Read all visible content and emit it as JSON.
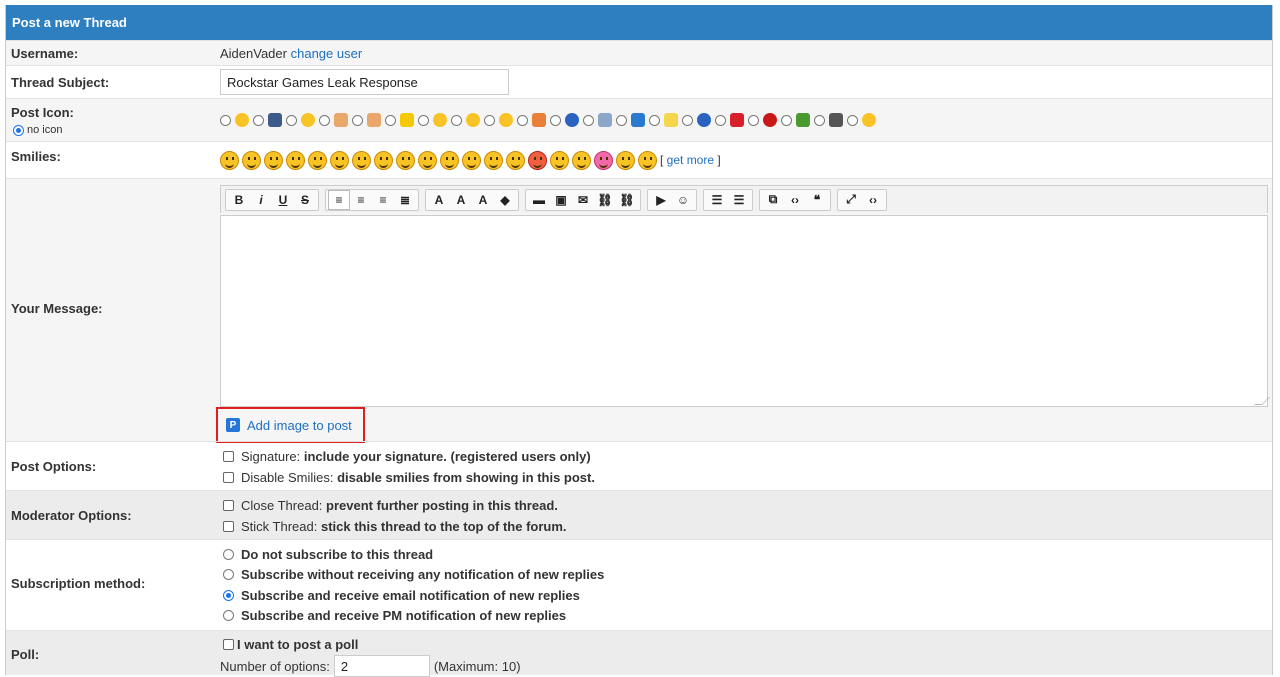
{
  "header": {
    "title": "Post a new Thread"
  },
  "username": {
    "label": "Username:",
    "value": "AidenVader",
    "change_link": "change user"
  },
  "subject": {
    "label": "Thread Subject:",
    "value": "Rockstar Games Leak Response"
  },
  "post_icon": {
    "label": "Post Icon:",
    "no_icon_label": "no icon",
    "icons": [
      {
        "name": "confused-icon",
        "color": "#f7c325"
      },
      {
        "name": "film-icon",
        "color": "#3c5a8a"
      },
      {
        "name": "tongue-icon",
        "color": "#f7c325"
      },
      {
        "name": "thumbs-up-icon",
        "color": "#e9a86a"
      },
      {
        "name": "thumbs-down-icon",
        "color": "#e9a86a"
      },
      {
        "name": "star-icon",
        "color": "#f5c800"
      },
      {
        "name": "big-grin-icon",
        "color": "#f7c325"
      },
      {
        "name": "angry-icon",
        "color": "#f7c325"
      },
      {
        "name": "neutral-icon",
        "color": "#f7c325"
      },
      {
        "name": "rainbow-icon",
        "color": "#e8803a"
      },
      {
        "name": "question-icon",
        "color": "#2a62c0"
      },
      {
        "name": "image-icon",
        "color": "#8aa8c8"
      },
      {
        "name": "music-icon",
        "color": "#2a7ad0"
      },
      {
        "name": "lightbulb-icon",
        "color": "#f5d54a"
      },
      {
        "name": "info-icon",
        "color": "#2a62c0"
      },
      {
        "name": "heart-icon",
        "color": "#d8202a"
      },
      {
        "name": "exclamation-icon",
        "color": "#c81818"
      },
      {
        "name": "bug-icon",
        "color": "#4a9a30"
      },
      {
        "name": "clapper-icon",
        "color": "#555555"
      },
      {
        "name": "laughing-icon",
        "color": "#f7c325"
      }
    ]
  },
  "smilies": {
    "label": "Smilies:",
    "count": 20,
    "get_more": "get more"
  },
  "message": {
    "label": "Your Message:",
    "add_image": "Add image to post"
  },
  "toolbar": {
    "groups": [
      [
        "B",
        "i",
        "U",
        "S"
      ],
      [
        "align-left",
        "align-center",
        "align-right",
        "justify"
      ],
      [
        "font",
        "size",
        "A",
        "eraser"
      ],
      [
        "hr",
        "image",
        "email",
        "link",
        "unlink"
      ],
      [
        "youtube",
        "emoticon"
      ],
      [
        "bullet-list",
        "ordered-list"
      ],
      [
        "code",
        "source",
        "quote"
      ],
      [
        "maximize",
        "view-source"
      ]
    ]
  },
  "post_options": {
    "label": "Post Options:",
    "items": [
      {
        "name": "Signature:",
        "desc": "include your signature. (registered users only)"
      },
      {
        "name": "Disable Smilies:",
        "desc": "disable smilies from showing in this post."
      }
    ]
  },
  "moderator_options": {
    "label": "Moderator Options:",
    "items": [
      {
        "name": "Close Thread:",
        "desc": "prevent further posting in this thread."
      },
      {
        "name": "Stick Thread:",
        "desc": "stick this thread to the top of the forum."
      }
    ]
  },
  "subscription": {
    "label": "Subscription method:",
    "options": [
      "Do not subscribe to this thread",
      "Subscribe without receiving any notification of new replies",
      "Subscribe and receive email notification of new replies",
      "Subscribe and receive PM notification of new replies"
    ],
    "selected_index": 2
  },
  "poll": {
    "label": "Poll:",
    "checkbox_label": "I want to post a poll",
    "options_label": "Number of options:",
    "options_value": "2",
    "maximum": "(Maximum: 10)"
  }
}
